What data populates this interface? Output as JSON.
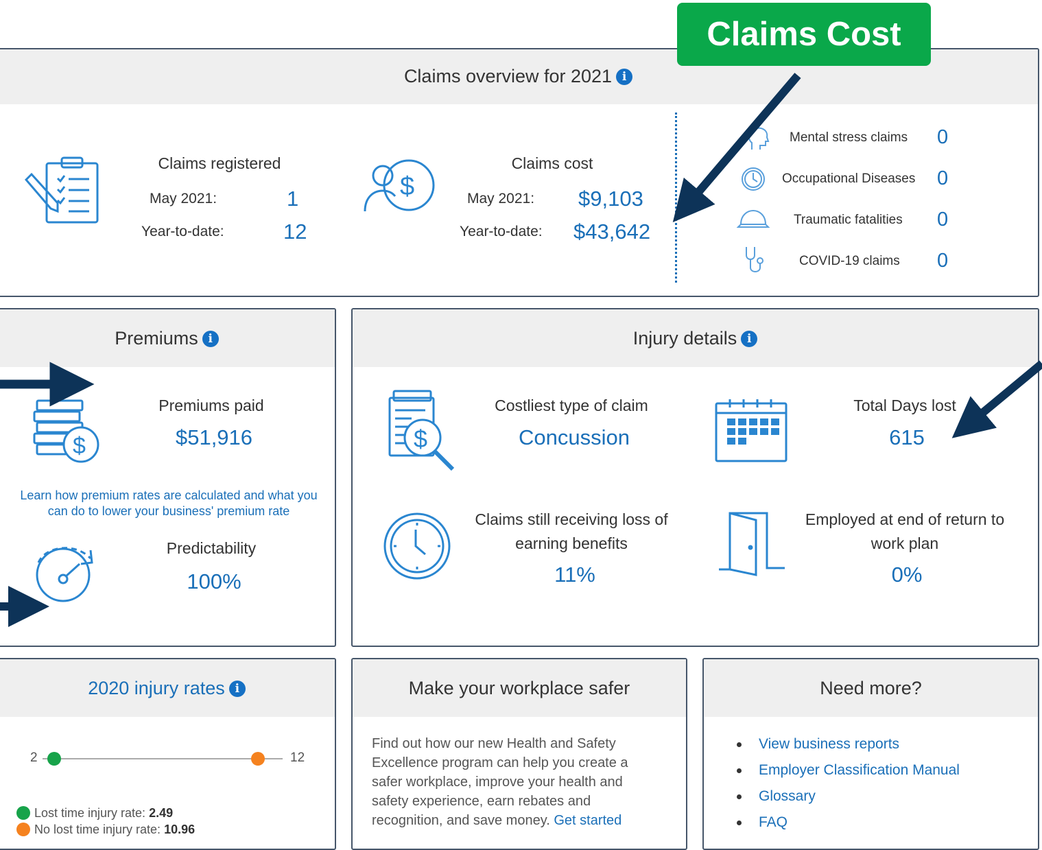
{
  "callout": {
    "label": "Claims Cost",
    "bg_color": "#0aa84a"
  },
  "overview": {
    "title": "Claims overview for 2021",
    "registered": {
      "title": "Claims registered",
      "month_label": "May 2021:",
      "month_value": "1",
      "ytd_label": "Year-to-date:",
      "ytd_value": "12"
    },
    "cost": {
      "title": "Claims cost",
      "month_label": "May 2021:",
      "month_value": "$9,103",
      "ytd_label": "Year-to-date:",
      "ytd_value": "$43,642"
    },
    "side": [
      {
        "icon": "head-icon",
        "label": "Mental stress claims",
        "value": "0"
      },
      {
        "icon": "clock-icon",
        "label": "Occupational Diseases",
        "value": "0"
      },
      {
        "icon": "hard-hat-icon",
        "label": "Traumatic fatalities",
        "value": "0"
      },
      {
        "icon": "stethoscope-icon",
        "label": "COVID-19 claims",
        "value": "0"
      }
    ]
  },
  "premiums": {
    "title": "Premiums",
    "paid_label": "Premiums paid",
    "paid_value": "$51,916",
    "learn_link": "Learn how premium rates are calculated and what you can do to lower your business' premium rate",
    "predictability_label": "Predictability",
    "predictability_value": "100%"
  },
  "injury": {
    "title": "Injury details",
    "costliest_label": "Costliest type of claim",
    "costliest_value": "Concussion",
    "days_label": "Total Days lost",
    "days_value": "615",
    "loss_label": "Claims still receiving loss of earning benefits",
    "loss_value": "11%",
    "employed_label": "Employed at end of return to work plan",
    "employed_value": "0%"
  },
  "rates": {
    "title": "2020 injury rates",
    "scale_min": "2",
    "scale_max": "12",
    "lost_time_rate": 2.49,
    "no_lost_time_rate": 10.96,
    "lost_label": "Lost time injury rate:",
    "lost_value": "2.49",
    "no_lost_label": "No lost time injury rate:",
    "no_lost_value": "10.96",
    "green": "#17a34a",
    "orange": "#f5821f"
  },
  "safer": {
    "title": "Make your workplace safer",
    "body": "Find out how our new Health and Safety Excellence program can help you create a safer workplace, improve your health and safety experience, earn rebates and recognition, and save money.",
    "link": "Get started"
  },
  "more": {
    "title": "Need more?",
    "links": [
      "View business reports",
      "Employer Classification Manual",
      "Glossary",
      "FAQ"
    ]
  },
  "colors": {
    "accent": "#1a6fb8",
    "arrow": "#0d3358",
    "border": "#46566a"
  }
}
